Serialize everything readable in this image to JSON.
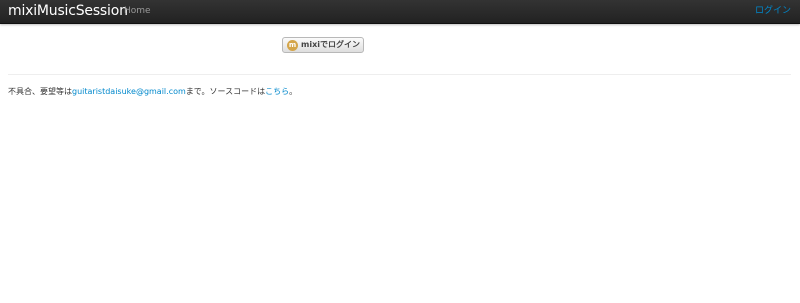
{
  "header": {
    "brand": "mixiMusicSession",
    "nav_home": "Home",
    "login": "ログイン",
    "colors": {
      "bar_top": "#333333",
      "bar_bottom": "#222222",
      "link_blue": "#0088cc"
    }
  },
  "main": {
    "mixi_button": {
      "logo_text": "m",
      "label": "mixiでログイン",
      "icon": "mixi-logo-icon"
    }
  },
  "footer": {
    "prefix": "不具合、要望等は",
    "email": "guitaristdaisuke@gmail.com",
    "middle": "まで。ソースコードは",
    "source_link": "こちら",
    "suffix": "。"
  }
}
